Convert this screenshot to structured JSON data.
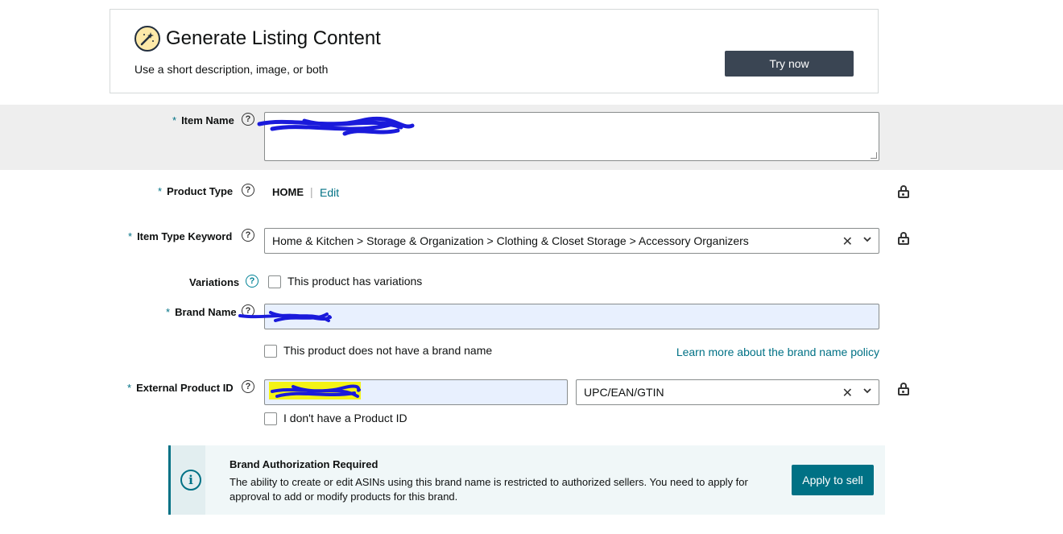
{
  "generate_card": {
    "title": "Generate Listing Content",
    "subtitle": "Use a short description, image, or both",
    "button_label": "Try now",
    "icon": "magic-wand-icon"
  },
  "form": {
    "required_marker": "*",
    "help_glyph": "?",
    "item_name": {
      "label": "Item Name",
      "value": ""
    },
    "product_type": {
      "label": "Product Type",
      "value": "HOME",
      "separator": "|",
      "edit_label": "Edit"
    },
    "item_type_keyword": {
      "label": "Item Type Keyword",
      "value": "Home & Kitchen > Storage & Organization > Clothing & Closet Storage > Accessory Organizers",
      "clear_glyph": "✕"
    },
    "variations": {
      "label": "Variations",
      "checkbox_label": "This product has variations"
    },
    "brand_name": {
      "label": "Brand Name",
      "value": "",
      "no_brand_label": "This product does not have a brand name",
      "policy_link": "Learn more about the brand name policy"
    },
    "external_product_id": {
      "label": "External Product ID",
      "value": "",
      "id_type": "UPC/EAN/GTIN",
      "clear_glyph": "✕",
      "no_id_label": "I don't have a Product ID"
    }
  },
  "alert": {
    "icon_glyph": "i",
    "title": "Brand Authorization Required",
    "body": "The ability to create or edit ASINs using this brand name is restricted to authorized sellers. You need to apply for approval to add or modify products for this brand.",
    "button_label": "Apply to sell"
  },
  "colors": {
    "accent": "#007185",
    "dark_button": "#3a4553",
    "band": "#eeeeee",
    "highlight": "#e8f0fe"
  }
}
